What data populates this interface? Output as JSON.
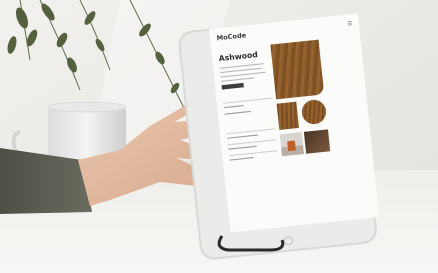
{
  "screen": {
    "brand": "MoCode",
    "product_title": "Ashwood"
  },
  "colors": {
    "wall": "#ecebe8",
    "desk": "#f3f2ef",
    "tablet_frame": "#d9d9d7",
    "wood": "#8a5a2a",
    "sleeve": "#5b5b50",
    "skin": "#e3bfa6",
    "mug": "#ededed"
  }
}
